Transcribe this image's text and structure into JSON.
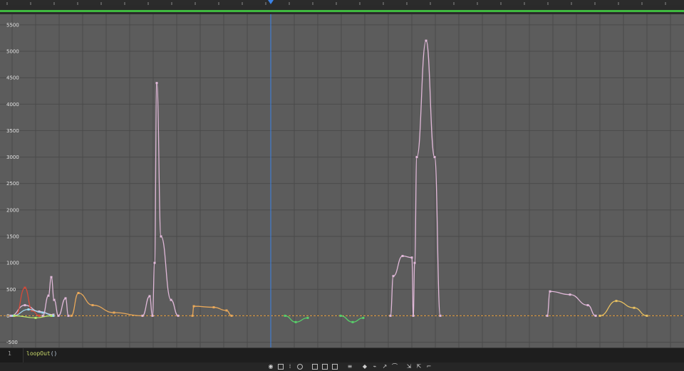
{
  "chart_data": {
    "type": "line",
    "title": "",
    "xlabel": "",
    "ylabel": "",
    "ylim": [
      -600,
      5700
    ],
    "yticks": [
      5500,
      5000,
      4500,
      4000,
      3500,
      3000,
      2500,
      2000,
      1500,
      1000,
      500,
      0,
      -500
    ],
    "ytick_labels": [
      "5500",
      "5000",
      "4500",
      "4000",
      "3500",
      "3000",
      "2500",
      "2000",
      "1500",
      "1000",
      "500",
      "0",
      "-500"
    ],
    "grid": true,
    "baseline_value": 0,
    "current_time_marker": "center playhead (blue vertical line)",
    "series": [
      {
        "color": "#e0b8d8",
        "points": [
          [
            15,
            0
          ],
          [
            35,
            200
          ],
          [
            55,
            80
          ],
          [
            75,
            20
          ]
        ]
      },
      {
        "color": "#d44a3a",
        "points": [
          [
            22,
            0
          ],
          [
            35,
            530
          ],
          [
            45,
            100
          ],
          [
            55,
            0
          ]
        ]
      },
      {
        "color": "#9fd8f0",
        "points": [
          [
            18,
            0
          ],
          [
            40,
            120
          ],
          [
            60,
            60
          ],
          [
            75,
            0
          ]
        ]
      },
      {
        "color": "#b8e86a",
        "points": [
          [
            20,
            0
          ],
          [
            50,
            -40
          ],
          [
            72,
            0
          ]
        ]
      },
      {
        "color": "#e0b8d8",
        "points": [
          [
            60,
            0
          ],
          [
            68,
            380
          ],
          [
            72,
            730
          ],
          [
            76,
            300
          ],
          [
            82,
            0
          ],
          [
            92,
            330
          ],
          [
            96,
            0
          ]
        ]
      },
      {
        "color": "#e8a85a",
        "points": [
          [
            100,
            0
          ],
          [
            110,
            430
          ],
          [
            130,
            200
          ],
          [
            160,
            60
          ],
          [
            200,
            0
          ]
        ]
      },
      {
        "color": "#e0b8d8",
        "points": [
          [
            200,
            0
          ],
          [
            210,
            370
          ],
          [
            214,
            0
          ],
          [
            217,
            1000
          ],
          [
            220,
            4400
          ],
          [
            226,
            1500
          ],
          [
            240,
            300
          ],
          [
            250,
            0
          ]
        ]
      },
      {
        "color": "#e8a85a",
        "points": [
          [
            270,
            0
          ],
          [
            272,
            180
          ],
          [
            300,
            160
          ],
          [
            318,
            100
          ],
          [
            325,
            0
          ]
        ]
      },
      {
        "color": "#58d06a",
        "points": [
          [
            400,
            0
          ],
          [
            415,
            -120
          ],
          [
            432,
            -40
          ]
        ]
      },
      {
        "color": "#58d06a",
        "points": [
          [
            478,
            0
          ],
          [
            495,
            -120
          ],
          [
            510,
            -40
          ]
        ]
      },
      {
        "color": "#e0b8d8",
        "points": [
          [
            548,
            0
          ],
          [
            552,
            750
          ],
          [
            565,
            1130
          ],
          [
            578,
            1100
          ],
          [
            580,
            0
          ],
          [
            582,
            1000
          ],
          [
            585,
            3000
          ],
          [
            598,
            5200
          ],
          [
            610,
            3000
          ],
          [
            618,
            0
          ]
        ]
      },
      {
        "color": "#e0b8d8",
        "points": [
          [
            768,
            0
          ],
          [
            772,
            460
          ],
          [
            800,
            400
          ],
          [
            825,
            200
          ],
          [
            836,
            0
          ]
        ]
      },
      {
        "color": "#e8c060",
        "points": [
          [
            842,
            0
          ],
          [
            865,
            280
          ],
          [
            890,
            150
          ],
          [
            908,
            0
          ]
        ]
      }
    ],
    "keyframe_markers": "small square keys on curves; orange dashed zero line"
  },
  "expression_editor": {
    "line_number": "1",
    "code_prefix": "loopOut",
    "code_suffix": "()"
  },
  "toolbar": {
    "icons": [
      "eye-icon",
      "graph-type-icon",
      "transform-box-icon",
      "snap-icon",
      "fit-selection-icon",
      "fit-all-icon",
      "separate-dimensions-icon",
      "edit-keyframe-icon",
      "convert-hold-icon",
      "convert-auto-bezier-icon",
      "easy-ease-icon",
      "easy-ease-in-icon",
      "easy-ease-out-icon"
    ]
  },
  "colors": {
    "graph_bg": "#5c5c5c",
    "grid": "#4a4a4a",
    "work_area_bar": "#3fb93f",
    "playhead": "#3b82e6",
    "zero_line": "#e8a040"
  }
}
